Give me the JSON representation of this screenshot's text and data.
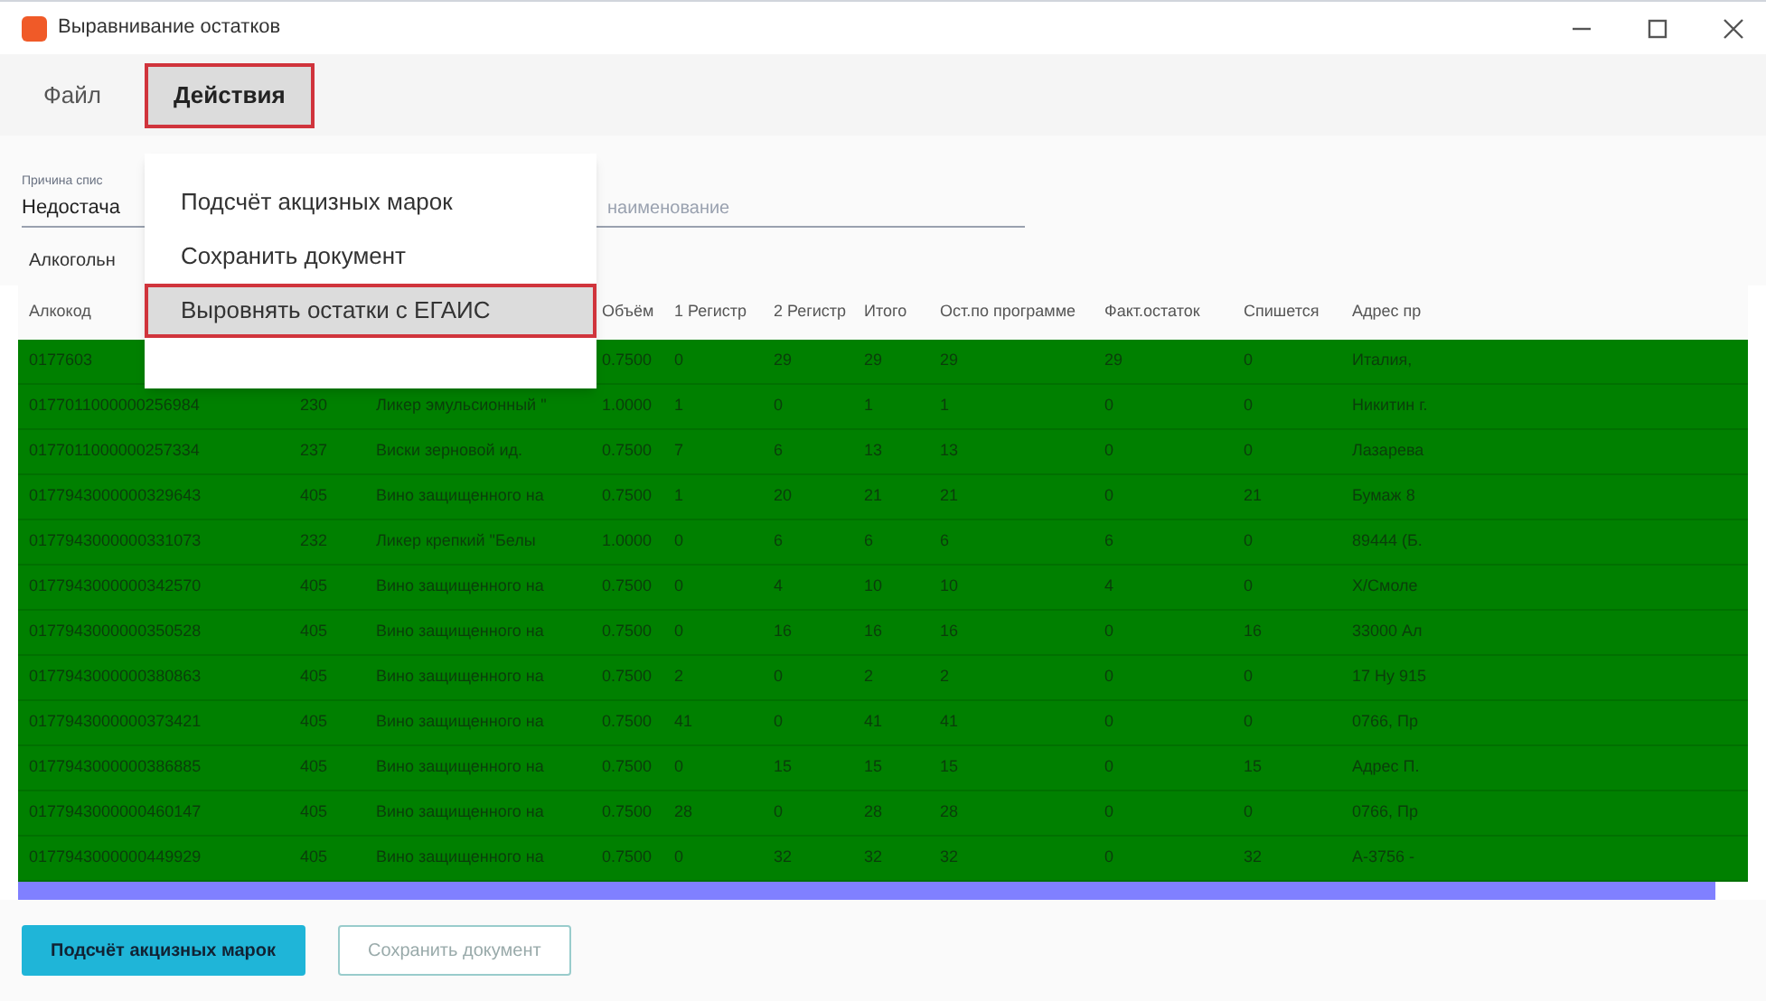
{
  "window": {
    "title": "Выравнивание остатков"
  },
  "menu": [
    {
      "label": "Файл",
      "selected": false,
      "highlighted": false
    },
    {
      "label": "Действия",
      "selected": true,
      "highlighted": true
    }
  ],
  "dropdown": [
    {
      "label": "Подсчёт акцизных марок",
      "hovered": false,
      "highlighted": false
    },
    {
      "label": "Сохранить документ",
      "hovered": false,
      "highlighted": false
    },
    {
      "label": "Выровнять остатки с ЕГАИС",
      "hovered": true,
      "highlighted": true
    }
  ],
  "filters": {
    "reason": {
      "label": "Причина спис",
      "value": "Недостача"
    },
    "search": {
      "placeholder": "наименование"
    },
    "section_label": "Алкогольн"
  },
  "table": {
    "columns": [
      "Алкокод",
      null,
      null,
      "Объём",
      "1 Регистр",
      "2 Регистр",
      "Итого",
      "Ост.по программе",
      "Факт.остаток",
      "Спишется",
      "Адрес пр"
    ],
    "rows": [
      {
        "cells": [
          "0177603",
          null,
          null,
          "0.7500",
          "0",
          "29",
          "29",
          "29",
          "29",
          "0",
          "Италия,"
        ]
      },
      {
        "cells": [
          "0177011000000256984",
          "230",
          "Ликер эмульсионный \"",
          "1.0000",
          "1",
          "0",
          "1",
          "1",
          "0",
          "0",
          "Никитин г."
        ]
      },
      {
        "cells": [
          "0177011000000257334",
          "237",
          "Виски зерновой ид.",
          "0.7500",
          "7",
          "6",
          "13",
          "13",
          "0",
          "0",
          "Лазарева"
        ]
      },
      {
        "cells": [
          "0177943000000329643",
          "405",
          "Вино защищенного на",
          "0.7500",
          "1",
          "20",
          "21",
          "21",
          "0",
          "21",
          "Бумаж 8"
        ]
      },
      {
        "cells": [
          "0177943000000331073",
          "232",
          "Ликер крепкий \"Белы",
          "1.0000",
          "0",
          "6",
          "6",
          "6",
          "6",
          "0",
          "89444 (Б."
        ]
      },
      {
        "cells": [
          "0177943000000342570",
          "405",
          "Вино защищенного на",
          "0.7500",
          "0",
          "4",
          "10",
          "10",
          "4",
          "0",
          "Х/Смоле"
        ]
      },
      {
        "cells": [
          "0177943000000350528",
          "405",
          "Вино защищенного на",
          "0.7500",
          "0",
          "16",
          "16",
          "16",
          "0",
          "16",
          "33000 Ал"
        ]
      },
      {
        "cells": [
          "0177943000000380863",
          "405",
          "Вино защищенного на",
          "0.7500",
          "2",
          "0",
          "2",
          "2",
          "0",
          "0",
          "17 Ну 915"
        ]
      },
      {
        "cells": [
          "0177943000000373421",
          "405",
          "Вино защищенного на",
          "0.7500",
          "41",
          "0",
          "41",
          "41",
          "0",
          "0",
          "0766, Пр"
        ]
      },
      {
        "cells": [
          "0177943000000386885",
          "405",
          "Вино защищенного на",
          "0.7500",
          "0",
          "15",
          "15",
          "15",
          "0",
          "15",
          "Адрес П."
        ]
      },
      {
        "cells": [
          "0177943000000460147",
          "405",
          "Вино защищенного на",
          "0.7500",
          "28",
          "0",
          "28",
          "28",
          "0",
          "0",
          "0766, Пр"
        ]
      },
      {
        "cells": [
          "0177943000000449929",
          "405",
          "Вино защищенного на",
          "0.7500",
          "0",
          "32",
          "32",
          "32",
          "0",
          "32",
          "А-3756 -"
        ]
      }
    ]
  },
  "buttons": [
    {
      "label": "Подсчёт акцизных марок",
      "kind": "primary"
    },
    {
      "label": "Сохранить документ",
      "kind": "secondary"
    }
  ]
}
